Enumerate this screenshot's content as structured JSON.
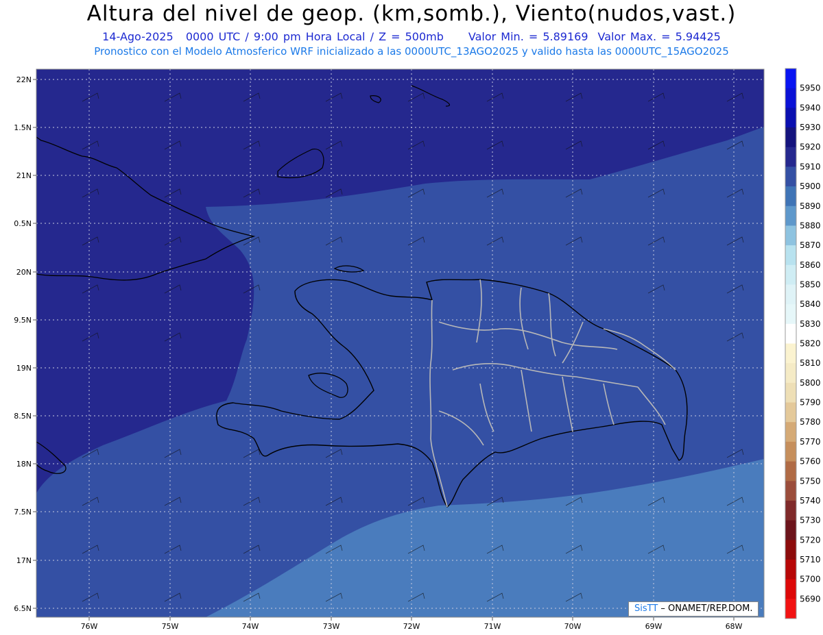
{
  "title": "Altura del nivel de geop. (km,somb.), Viento(nudos,vast.)",
  "subtitle": {
    "date": "14-Ago-2025",
    "time": "0000 UTC / 9:00 pm Hora Local / Z = 500mb",
    "min": "Valor Min. = 5.89169",
    "max": "Valor Max. = 5.94425"
  },
  "subtitle2": "Pronostico con el Modelo Atmosferico WRF inicializado a las 0000UTC_13AGO2025 y valido hasta las  0000UTC_15AGO2025",
  "lat_labels": [
    "22N",
    "1.5N",
    "21N",
    "0.5N",
    "20N",
    "9.5N",
    "19N",
    "8.5N",
    "18N",
    "7.5N",
    "17N",
    "6.5N"
  ],
  "lon_labels": [
    "76W",
    "75W",
    "74W",
    "73W",
    "72W",
    "71W",
    "70W",
    "69W",
    "68W"
  ],
  "colorbar": {
    "levels": [
      "5950",
      "5940",
      "5930",
      "5920",
      "5910",
      "5900",
      "5890",
      "5880",
      "5870",
      "5860",
      "5850",
      "5840",
      "5830",
      "5820",
      "5810",
      "5800",
      "5790",
      "5780",
      "5770",
      "5760",
      "5750",
      "5740",
      "5730",
      "5720",
      "5710",
      "5700",
      "5690"
    ],
    "colors": [
      "#0814f2",
      "#0a11d6",
      "#0a0fb0",
      "#14137d",
      "#25288e",
      "#3450a4",
      "#3f74b6",
      "#5e98cb",
      "#8ec3e0",
      "#b8e2ef",
      "#cfedf4",
      "#dff3f7",
      "#e6f7f9",
      "#ffffff",
      "#fbf3d0",
      "#f5ebc6",
      "#eedfb6",
      "#e4c99a",
      "#d5aa76",
      "#c68f5c",
      "#b06b45",
      "#9b4d3b",
      "#7f2a2a",
      "#6c141b",
      "#8c0b0b",
      "#b70707",
      "#dd0808",
      "#f21212"
    ]
  },
  "shading_colors": {
    "level_5920": "#25288e",
    "level_5910": "#3450a4",
    "level_5900": "#4a7cbd"
  },
  "credit": {
    "brand": "SisTT",
    "text": " –  ONAMET/REP.DOM."
  }
}
